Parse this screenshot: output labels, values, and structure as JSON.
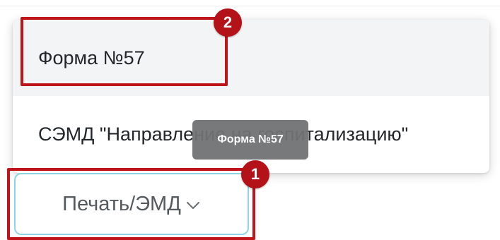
{
  "dropdown": {
    "items": [
      {
        "label": "Форма №57"
      },
      {
        "label": "СЭМД \"Направление на госпитализацию\""
      }
    ]
  },
  "tooltip": {
    "text": "Форма №57"
  },
  "print_button": {
    "label": "Печать/ЭМД",
    "icon": "chevron-down-icon"
  },
  "annotations": {
    "badge_1": "1",
    "badge_2": "2",
    "color": "#c0141b"
  },
  "colors": {
    "button_border": "#8fd4e6",
    "tooltip_bg": "#707274",
    "hover_bg": "#f3f4f5"
  }
}
